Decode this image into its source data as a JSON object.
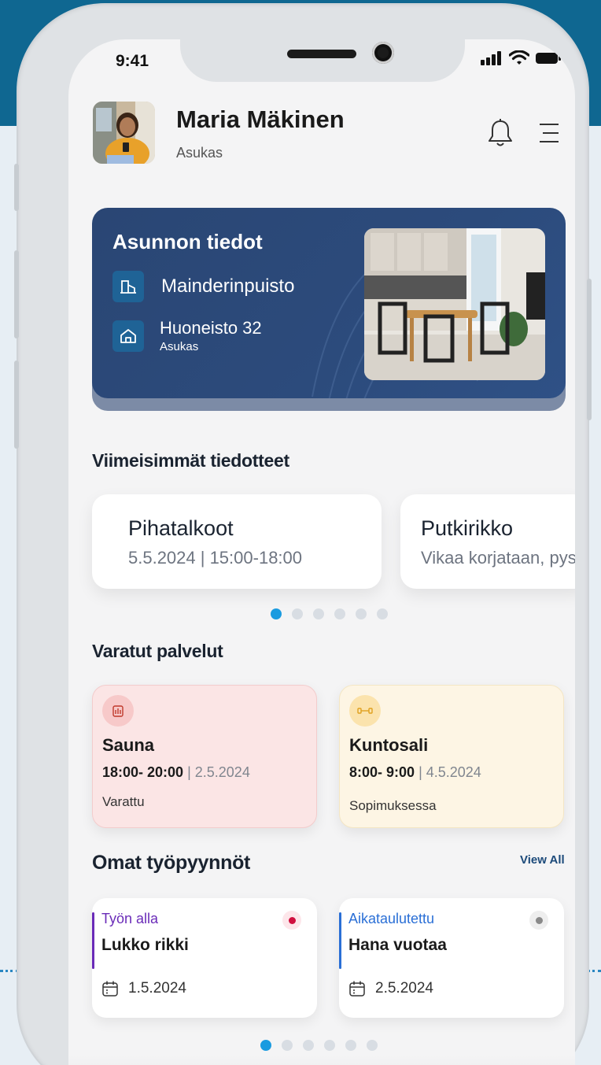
{
  "status_bar": {
    "time": "9:41"
  },
  "header": {
    "user_name": "Maria Mäkinen",
    "user_role": "Asukas",
    "icons": [
      "bell-icon",
      "menu-icon"
    ]
  },
  "apartment": {
    "title": "Asunnon tiedot",
    "building": "Mainderinpuisto",
    "unit": "Huoneisto 32",
    "unit_role": "Asukas"
  },
  "announcements": {
    "section_title": "Viimeisimmät tiedotteet",
    "items": [
      {
        "title": "Pihatalkoot",
        "subtitle": "5.5.2024 | 15:00-18:00"
      },
      {
        "title": "Putkirikko",
        "subtitle": "Vikaa korjataan, pysy"
      }
    ],
    "pager": {
      "count": 6,
      "active": 1
    }
  },
  "services": {
    "section_title": "Varatut palvelut",
    "items": [
      {
        "name": "Sauna",
        "time": "18:00- 20:00",
        "separator": " | ",
        "date": "2.5.2024",
        "status": "Varattu",
        "icon": "sauna-icon",
        "color": "#fbe5e5"
      },
      {
        "name": "Kuntosali",
        "time": "8:00- 9:00",
        "separator": " | ",
        "date": "4.5.2024",
        "status": "Sopimuksessa",
        "icon": "dumbbell-icon",
        "color": "#fdf5e4"
      }
    ]
  },
  "work_requests": {
    "section_title": "Omat työpyynnöt",
    "view_all": "View All",
    "items": [
      {
        "status": "Työn alla",
        "title": "Lukko rikki",
        "date": "1.5.2024",
        "status_color": "#6a2bb8",
        "dot_color": "#d0103f"
      },
      {
        "status": "Aikataulutettu",
        "title": "Hana vuotaa",
        "date": "2.5.2024",
        "status_color": "#2a6fd6",
        "dot_color": "#8a8a8a"
      }
    ],
    "pager": {
      "count": 6,
      "active": 1
    }
  },
  "colors": {
    "accent": "#1a9be0",
    "card_navy": "#2c4b7c",
    "frame_blue": "#0f6791"
  }
}
